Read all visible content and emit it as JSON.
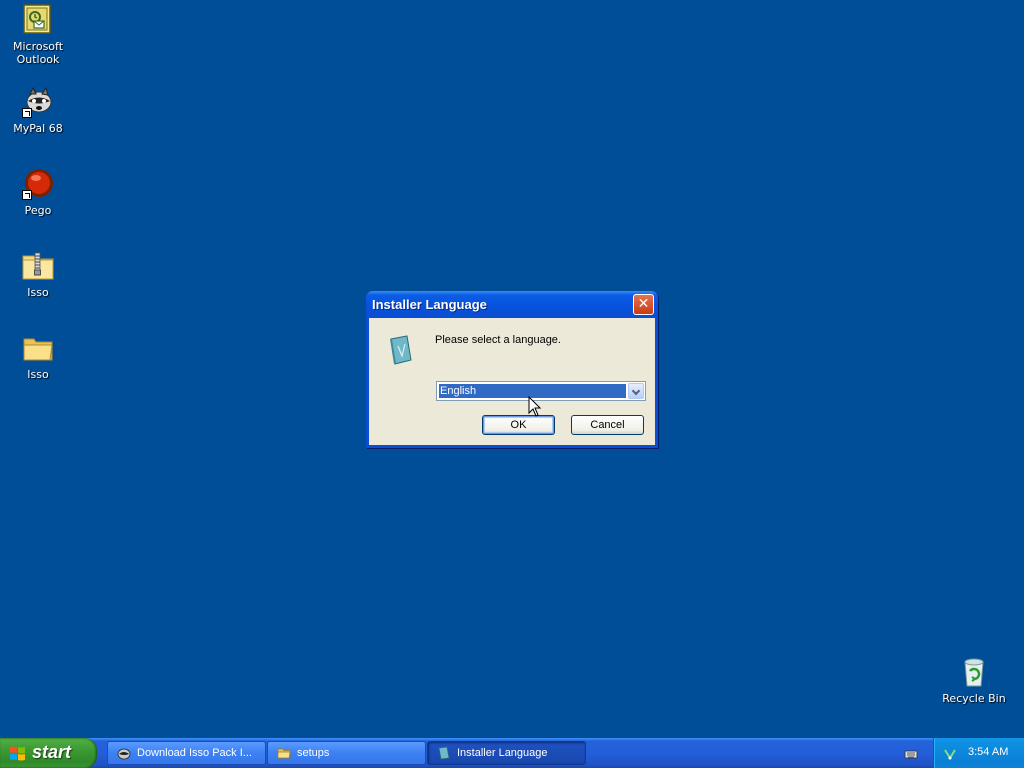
{
  "desktop": {
    "background_color": "#004e98",
    "icons": [
      {
        "label_line1": "Microsoft",
        "label_line2": "Outlook",
        "icon": "outlook-icon"
      },
      {
        "label_line1": "MyPal 68",
        "label_line2": "",
        "icon": "mypal-raccoon-icon"
      },
      {
        "label_line1": "Pego",
        "label_line2": "",
        "icon": "pego-red-ball-icon"
      },
      {
        "label_line1": "Isso",
        "label_line2": "",
        "icon": "zip-folder-icon"
      },
      {
        "label_line1": "Isso",
        "label_line2": "",
        "icon": "folder-icon"
      },
      {
        "label_line1": "Recycle Bin",
        "label_line2": "",
        "icon": "recycle-bin-icon"
      }
    ]
  },
  "dialog": {
    "title": "Installer Language",
    "close_symbol": "✕",
    "prompt": "Please select a language.",
    "language_selected": "English",
    "ok_label": "OK",
    "cancel_label": "Cancel",
    "icon": "installer-icon"
  },
  "taskbar": {
    "start_label": "start",
    "tasks": [
      {
        "label": "Download Isso Pack I...",
        "icon": "mypal-raccoon-icon",
        "active": false
      },
      {
        "label": "setups",
        "icon": "folder-icon",
        "active": false
      },
      {
        "label": "Installer Language",
        "icon": "installer-icon",
        "active": true
      }
    ],
    "clock": "3:54 AM"
  },
  "colors": {
    "title_bar": "#0751dc",
    "taskbar": "#245edb",
    "start_button": "#3c9a34",
    "selection": "#316ac5"
  }
}
